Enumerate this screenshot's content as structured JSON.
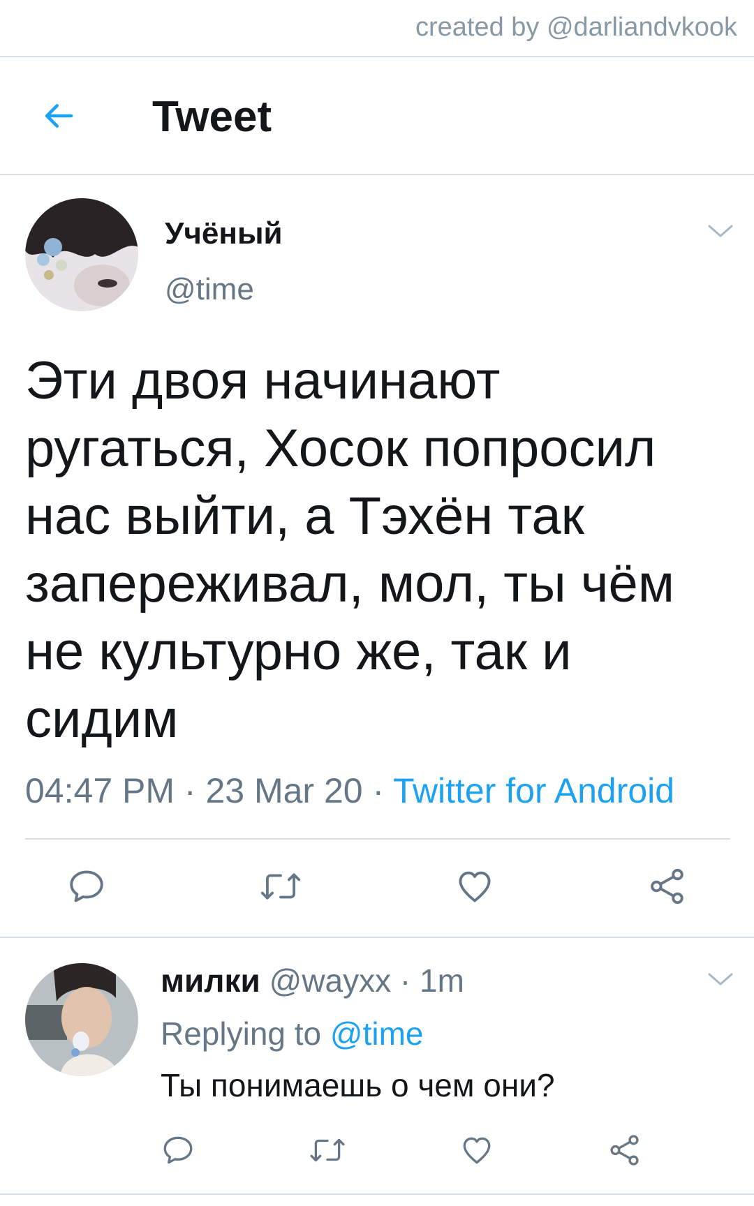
{
  "credit": "created by @darliandvkook",
  "header": {
    "title": "Tweet",
    "back_icon": "arrow-left-icon"
  },
  "colors": {
    "accent": "#1da1f2",
    "secondary_text": "#657786",
    "primary_text": "#14171a",
    "divider": "#d8dee4"
  },
  "main_tweet": {
    "name": "Учёный",
    "handle": "@time",
    "text": "Эти двоя начинают ругаться, Хосок попросил нас выйти, а Тэхён так запереживал, мол, ты чём не культурно же, так и сидим",
    "time": "04:47 PM",
    "sep1": " · ",
    "date": "23 Mar 20",
    "sep2": " · ",
    "source": "Twitter for Android",
    "actions": [
      "reply-icon",
      "retweet-icon",
      "like-icon",
      "share-icon"
    ]
  },
  "reply": {
    "name": "милки",
    "handle": "@wayxx",
    "sep": " · ",
    "time": "1m",
    "replying_prefix": "Replying to ",
    "replying_to": "@time",
    "text": "Ты понимаешь о чем они?",
    "actions": [
      "reply-icon",
      "retweet-icon",
      "like-icon",
      "share-icon"
    ]
  }
}
